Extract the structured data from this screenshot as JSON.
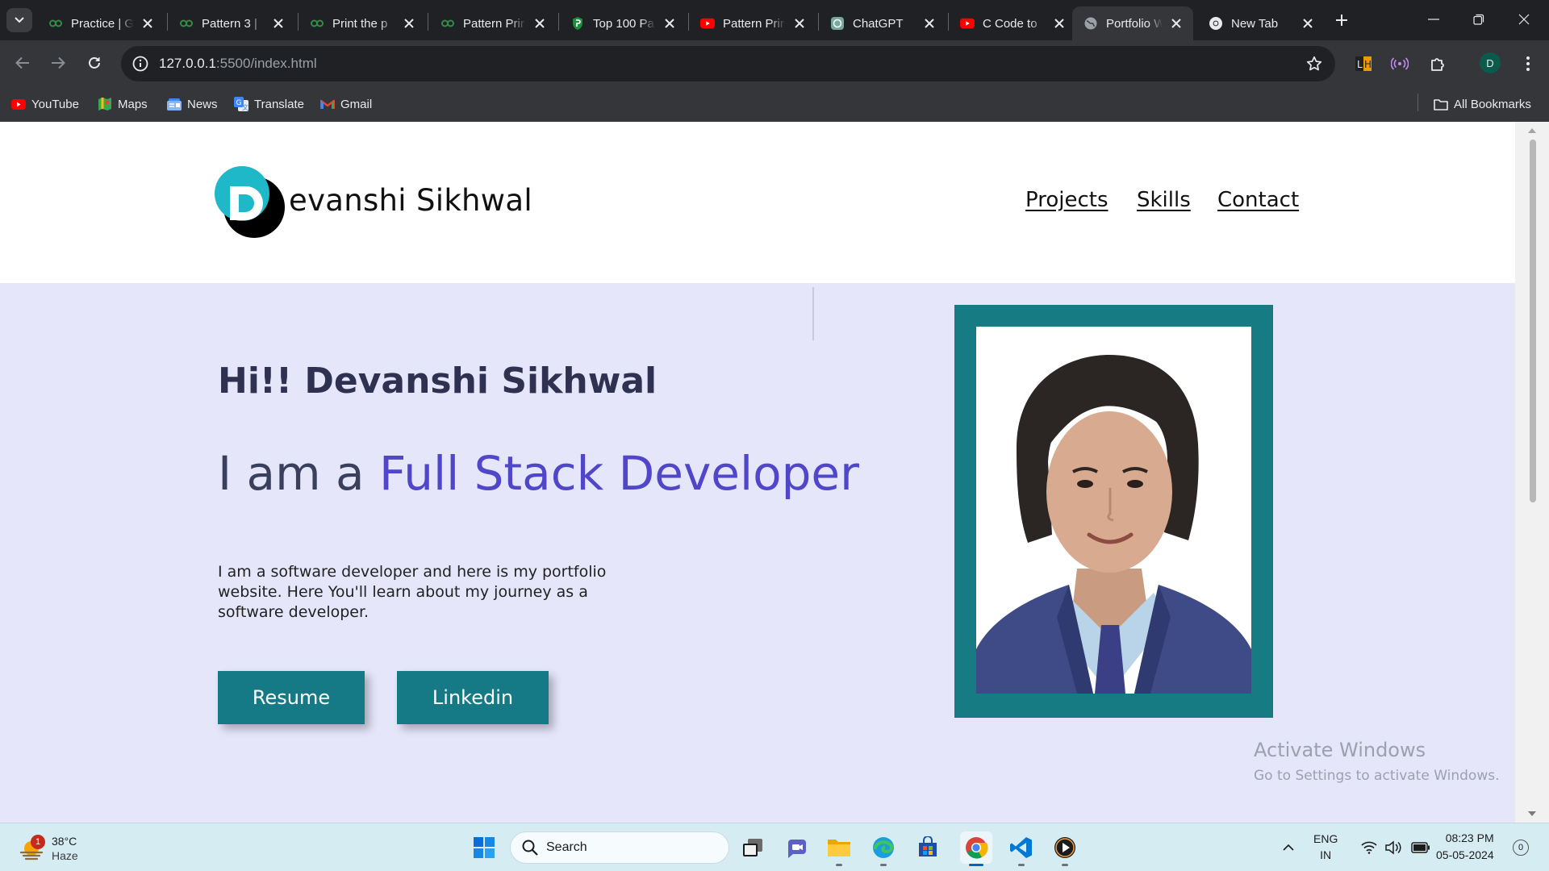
{
  "browser": {
    "tabs": [
      {
        "title": "Practice | G",
        "icon": "gfg-icon",
        "color": "#2f8d46"
      },
      {
        "title": "Pattern 3 |",
        "icon": "gfg-icon",
        "color": "#2f8d46"
      },
      {
        "title": "Print the p",
        "icon": "gfg-icon",
        "color": "#2f8d46"
      },
      {
        "title": "Pattern Prir",
        "icon": "gfg-icon",
        "color": "#2f8d46"
      },
      {
        "title": "Top 100 Pa",
        "icon": "shield-icon",
        "color": "#1e8e3e"
      },
      {
        "title": "Pattern Prir",
        "icon": "youtube-icon",
        "color": "#ff0000"
      },
      {
        "title": "ChatGPT",
        "icon": "chatgpt-icon",
        "color": "#74aa9c"
      },
      {
        "title": "C Code to",
        "icon": "youtube-icon",
        "color": "#ff0000"
      },
      {
        "title": "Portfolio W",
        "icon": "globe-icon",
        "color": "#9aa0a6",
        "active": true
      },
      {
        "title": "New Tab",
        "icon": "chrome-icon",
        "color": "#e8eaed"
      }
    ],
    "address": {
      "host": "127.0.0.1",
      "rest": ":5500/index.html"
    },
    "bookmarks": [
      {
        "label": "YouTube",
        "icon": "youtube-icon"
      },
      {
        "label": "Maps",
        "icon": "maps-icon"
      },
      {
        "label": "News",
        "icon": "news-icon"
      },
      {
        "label": "Translate",
        "icon": "translate-icon"
      },
      {
        "label": "Gmail",
        "icon": "gmail-icon"
      }
    ],
    "all_bookmarks": "All Bookmarks",
    "profile_initial": "D"
  },
  "site": {
    "logo_name": "evanshi Sikhwal",
    "logo_letter": "D",
    "nav": [
      "Projects",
      "Skills",
      "Contact"
    ],
    "greeting": "Hi!! Devanshi Sikhwal",
    "role_prefix": "I am a ",
    "role_accent": "Full Stack Developer",
    "description": "I am a software developer and here is my portfolio website. Here You'll learn about my journey as a software developer.",
    "buttons": {
      "resume": "Resume",
      "linkedin": "Linkedin"
    },
    "colors": {
      "accent": "#4f46c9",
      "teal": "#157a86",
      "hero_bg": "#e5e6fa"
    }
  },
  "watermark": {
    "title": "Activate Windows",
    "subtitle": "Go to Settings to activate Windows."
  },
  "taskbar": {
    "weather": {
      "temp": "38°C",
      "condition": "Haze",
      "badge": "1"
    },
    "search_placeholder": "Search",
    "language": {
      "line1": "ENG",
      "line2": "IN"
    },
    "time": "08:23 PM",
    "date": "05-05-2024",
    "notifications": "0"
  }
}
